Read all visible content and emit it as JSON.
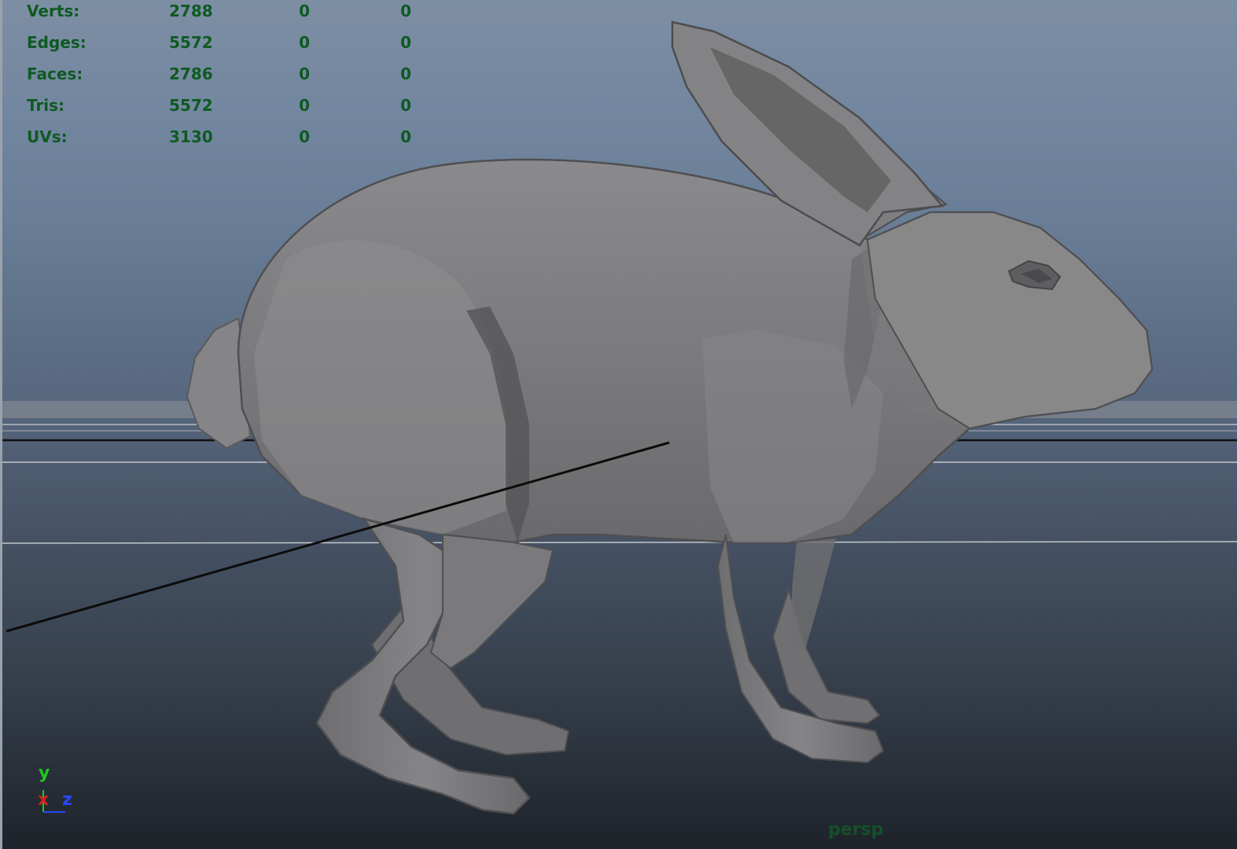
{
  "viewport": {
    "camera_name": "persp",
    "model": "rabbit-mesh",
    "colors": {
      "hud_text": "#0e5a22",
      "axis_x": "#d21e1e",
      "axis_y": "#1ec81e",
      "axis_z": "#2846ff",
      "mesh": "#7e7e80"
    }
  },
  "hud": {
    "rows": [
      {
        "label": "Verts:",
        "c1": "2788",
        "c2": "0",
        "c3": "0"
      },
      {
        "label": "Edges:",
        "c1": "5572",
        "c2": "0",
        "c3": "0"
      },
      {
        "label": "Faces:",
        "c1": "2786",
        "c2": "0",
        "c3": "0"
      },
      {
        "label": "Tris:",
        "c1": "5572",
        "c2": "0",
        "c3": "0"
      },
      {
        "label": "UVs:",
        "c1": "3130",
        "c2": "0",
        "c3": "0"
      }
    ]
  },
  "axis_gizmo": {
    "x_label": "x",
    "y_label": "y",
    "z_label": "z"
  }
}
